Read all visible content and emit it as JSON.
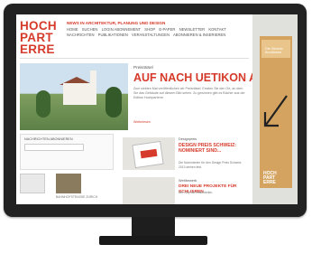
{
  "site": {
    "logo_lines": [
      "HOCH",
      "PART",
      "ERRE"
    ],
    "tagline": "NEWS IN ARCHITEKTUR, PLANUNG UND DESIGN",
    "nav_row1": [
      "HOME",
      "SUCHEN",
      "LOGIN ABONNEMENT",
      "SHOP",
      "E-PAPER",
      "NEWSLETTER",
      "KONTAKT"
    ],
    "nav_row2": [
      "NACHRICHTEN",
      "PUBLIKATIONEN",
      "VERANSTALTUNGEN",
      "ABONNIEREN & INSERIEREN"
    ]
  },
  "hero": {
    "kicker": "Preisrätsel",
    "headline": "AUF NACH UETIKON AM SEE?",
    "body": "Zum siebten Mal veröffentlichen wir Preisrätsel. Erraten Sie den Ort, an dem Sie das Gebäude auf diesem Bild sehen. Zu gewinnen gibt es Bücher aus der Edition Hochparterre.",
    "read_more": "Weiterlesen"
  },
  "newsletter": {
    "title": "NACHRICHTEN ABONNIEREN"
  },
  "thumbs": {
    "caption2": "BAHNHOFSTRASSE ZÜRICH"
  },
  "news2": {
    "kicker": "Designpreis",
    "title": "DESIGN PREIS SCHWEIZ: NOMINIERT SIND...",
    "text": "Die Nominierten für den Design Preis Schweiz 2013 stehen fest."
  },
  "news3": {
    "kicker": "Wettbewerb",
    "title": "DREI NEUE PROJEKTE FÜR SCHLIEREN",
    "text": "Die Jury hat entschieden."
  },
  "ad": {
    "text": "Die Zürcher Architektur",
    "logo_lines": [
      "HOCH",
      "PART",
      "ERRE"
    ]
  },
  "colors": {
    "accent": "#d63a2a",
    "ad": "#d4a35f",
    "bezel": "#222222"
  }
}
